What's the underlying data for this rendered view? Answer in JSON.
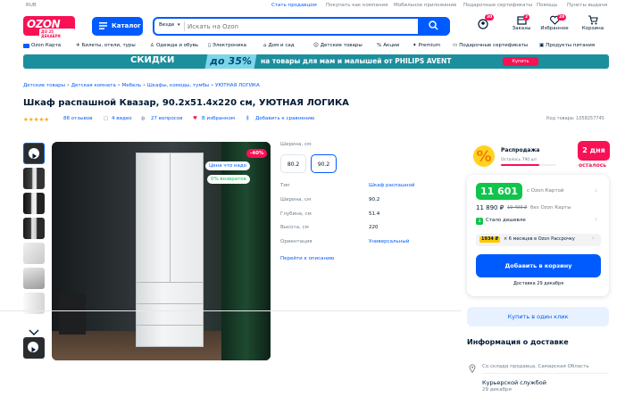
{
  "topbar": {
    "currency": "RUB",
    "links": [
      "Стать продавцом",
      "Покупать как компания",
      "Мобильное приложение",
      "Подарочные сертификаты",
      "Помощь",
      "Пункты выдачи"
    ]
  },
  "header": {
    "logo_text": "OZON",
    "logo_sub": "ДО 25 ДЕКАБРЯ",
    "catalog_label": "Каталог",
    "search_scope": "Везде",
    "search_placeholder": "Искать на Ozon",
    "icons": [
      {
        "name": "profile-icon",
        "label": "",
        "badge": "30"
      },
      {
        "name": "orders-icon",
        "label": "Заказы",
        "badge": "2"
      },
      {
        "name": "favorites-icon",
        "label": "Избранное",
        "badge": "28"
      },
      {
        "name": "cart-icon",
        "label": "Корзина",
        "badge": ""
      }
    ]
  },
  "nav": {
    "items": [
      "Ozon Карта",
      "Билеты, отели, туры",
      "Одежда и обувь",
      "Электроника",
      "Дом и сад",
      "Детские товары",
      "Акции",
      "Premium",
      "Подарочные сертификаты",
      "Продукты питания"
    ]
  },
  "banner": {
    "sale": "СКИДКИ",
    "percent": "до 35%",
    "message": "на товары для мам и малышей от PHILIPS AVENT",
    "button": "Купить"
  },
  "breadcrumbs": [
    "Детские товары",
    "Детская комната",
    "Мебель",
    "Шкафы, комоды, тумбы",
    "УЮТНАЯ ЛОГИКА"
  ],
  "product": {
    "title": "Шкаф распашной Квазар, 90.2x51.4x220 см, УЮТНАЯ ЛОГИКА",
    "reviews": "88 отзывов",
    "videos": "4 видео",
    "questions": "27 вопросов",
    "favorite": "В избранном",
    "compare": "Добавить к сравнению",
    "sku": "Код товара: 1058257745",
    "rating": 5,
    "discount_tag": "-40%",
    "price_tag": "Цена что надо",
    "returns_tag": "0% возвратов"
  },
  "options": {
    "width_label": "Ширина, см:",
    "sizes": [
      "80.2",
      "90.2"
    ],
    "selected_size": "90.2"
  },
  "specs": [
    {
      "key": "Тип",
      "value": "Шкаф распашной",
      "link": true
    },
    {
      "key": "Ширина, см",
      "value": "90.2",
      "link": false
    },
    {
      "key": "Глубина, см",
      "value": "51.4",
      "link": false
    },
    {
      "key": "Высота, см",
      "value": "220",
      "link": false
    },
    {
      "key": "Ориентация",
      "value": "Универсальный",
      "link": true
    }
  ],
  "specs_link": "Перейти к описанию",
  "promo": {
    "title": "Распродажа",
    "remaining": "Осталось 790 шт",
    "days": "2 дня",
    "days_sub": "осталось"
  },
  "pricing": {
    "card_price": "11 601 ₽",
    "card_label": "с Ozon Картой",
    "price": "11 890 ₽",
    "old_price": "19 400 ₽",
    "no_card_label": "без Ozon Карты",
    "cheaper": "Стало дешевле",
    "installment_amount": "1934 ₽",
    "installment_text": "× 6 месяцев в Ozon Рассрочку",
    "add_to_cart": "Добавить в корзину",
    "delivery": "Доставка 29 декабря",
    "one_click": "Купить в один клик"
  },
  "delivery_info": {
    "title": "Информация о доставке",
    "from": "Со склада продавца, Самарская Область",
    "courier": "Курьерской службой",
    "courier_date": "29 декабря"
  },
  "colors": {
    "accent": "#005bff",
    "pink": "#f91155",
    "green": "#10c44c"
  }
}
